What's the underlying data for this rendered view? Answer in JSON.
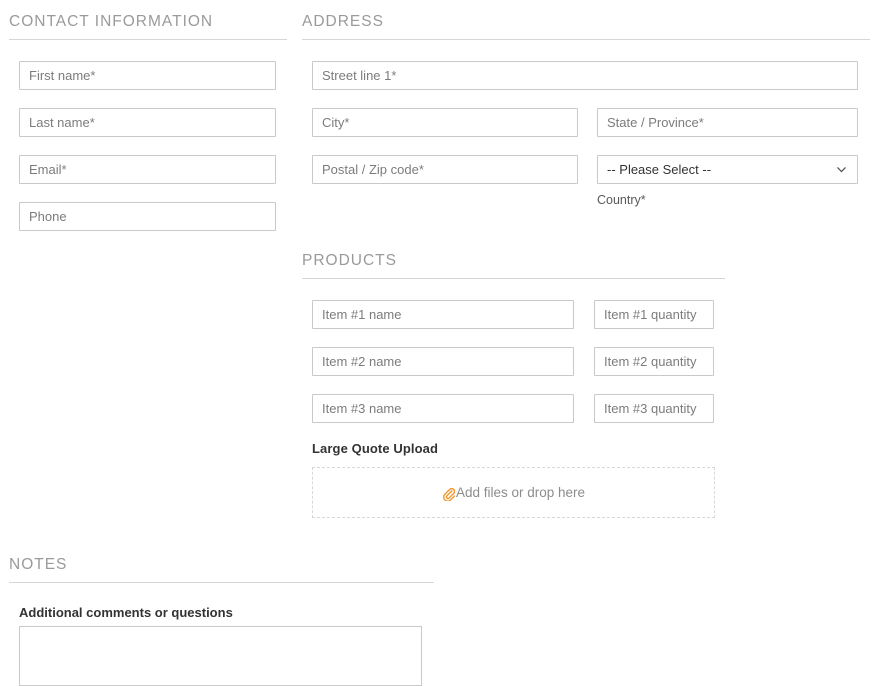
{
  "sections": {
    "contact": {
      "title": "CONTACT INFORMATION",
      "fields": [
        {
          "name": "first-name",
          "placeholder": "First name*"
        },
        {
          "name": "last-name",
          "placeholder": "Last name*"
        },
        {
          "name": "email",
          "placeholder": "Email*"
        },
        {
          "name": "phone",
          "placeholder": "Phone"
        }
      ]
    },
    "address": {
      "title": "ADDRESS",
      "street_placeholder": "Street line 1*",
      "city_placeholder": "City*",
      "state_placeholder": "State / Province*",
      "postal_placeholder": "Postal / Zip code*",
      "country_selected": "-- Please Select --",
      "country_label": "Country*",
      "chevron_icon": "chevron-down-icon"
    },
    "products": {
      "title": "PRODUCTS",
      "rows": [
        {
          "name_placeholder": "Item #1 name",
          "qty_placeholder": "Item #1 quantity"
        },
        {
          "name_placeholder": "Item #2 name",
          "qty_placeholder": "Item #2 quantity"
        },
        {
          "name_placeholder": "Item #3 name",
          "qty_placeholder": "Item #3 quantity"
        }
      ],
      "upload_label": "Large Quote Upload",
      "dropzone_text": "Add files or drop here",
      "dropzone_icon": "paperclip-icon"
    },
    "notes": {
      "title": "NOTES",
      "label": "Additional comments or questions",
      "value": "",
      "placeholder": ""
    }
  },
  "colors": {
    "heading": "#9a9a9a",
    "rule": "#d6d6d6",
    "field_border": "#c9c9c9",
    "placeholder": "#7c7c7c",
    "accent_orange": "#f0962e",
    "dropzone_border": "#d8d8d8",
    "label_text": "#333333"
  }
}
